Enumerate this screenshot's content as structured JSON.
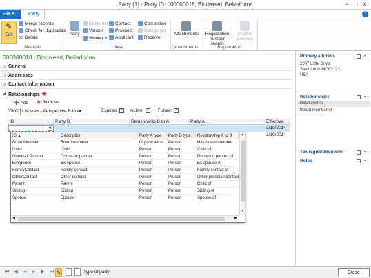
{
  "window": {
    "title": "Party (1) - Party ID: 000000018,  Bindweed, Belladonna",
    "help": "?",
    "minimize": "−",
    "maximize": "□",
    "close": "✕"
  },
  "tabs": {
    "file": "File",
    "party": "Party"
  },
  "ribbon": {
    "edit": "Edit",
    "merge": "Merge records",
    "check_dup": "Check for duplicates",
    "delete": "Delete",
    "maintain": "Maintain",
    "party": "Party",
    "customer": "Customer",
    "vendor": "Vendor",
    "worker": "Worker",
    "contact": "Contact",
    "prospect": "Prospect",
    "applicant": "Applicant",
    "competitor": "Competitor",
    "categories": "Categories",
    "receiver": "Receiver",
    "new": "New",
    "attachments": "Attachments",
    "attachments_group": "Attachments",
    "reg_search": "Registration number search",
    "alcohol": "Alcohol licenses",
    "registration": "Registration"
  },
  "header": {
    "title": "000000018 : Bindweed, Belladonna"
  },
  "fasttabs": {
    "general": "General",
    "addresses": "Addresses",
    "contact": "Contact information",
    "relationships": "Relationships"
  },
  "grid_toolbar": {
    "add": "Add",
    "remove": "Remove",
    "view_label": "View:",
    "view_value": "List view - Perspective B to A",
    "expired": "Expired:",
    "active": "Active:",
    "future": "Future:"
  },
  "grid": {
    "columns": [
      "ID",
      "Party B",
      "Relationship B to A",
      "Party A",
      "Effective:"
    ],
    "rows": [
      {
        "effective": "3/19/2014"
      },
      {
        "effective": "3/19/2014"
      }
    ]
  },
  "lookup": {
    "columns": [
      "ID",
      "Description",
      "Party A type",
      "Party B type",
      "Relationship A to B"
    ],
    "rows": [
      [
        "BoardMember",
        "Board member",
        "Organization",
        "Person",
        "Has board member"
      ],
      [
        "Child",
        "Child",
        "Person",
        "Person",
        "Child of"
      ],
      [
        "DomesticPartner",
        "Domestic partner",
        "Person",
        "Person",
        "Domestic partner of"
      ],
      [
        "ExSpouse",
        "Ex-spouse",
        "Person",
        "Person",
        "Ex-spouse of"
      ],
      [
        "FamilyContact",
        "Family contact",
        "Person",
        "Person",
        "Family contact of"
      ],
      [
        "OtherContact",
        "Other contact",
        "Person",
        "Person",
        "Other personal contact"
      ],
      [
        "Parent",
        "Parent",
        "Person",
        "Person",
        "Child of"
      ],
      [
        "Sibling",
        "Sibling",
        "Person",
        "Person",
        "Sibling of"
      ],
      [
        "Spouse",
        "Spouse",
        "Person",
        "Person",
        "Spouse of"
      ]
    ]
  },
  "rightpane": {
    "primary_address": "Primary address",
    "addr1": "2037 Little Drive",
    "addr2": "Saint Louis,MO63123",
    "addr3": "USA",
    "relationships": "Relationships",
    "rel_h": "Relationship",
    "rel_v": "Board member of",
    "tax": "Tax registration info",
    "roles": "Roles"
  },
  "status": {
    "text": "Type of party",
    "close": "Close"
  },
  "colors": {
    "accent": "#1e73be",
    "header_green": "#2a7a2a",
    "required": "#c0392b"
  }
}
